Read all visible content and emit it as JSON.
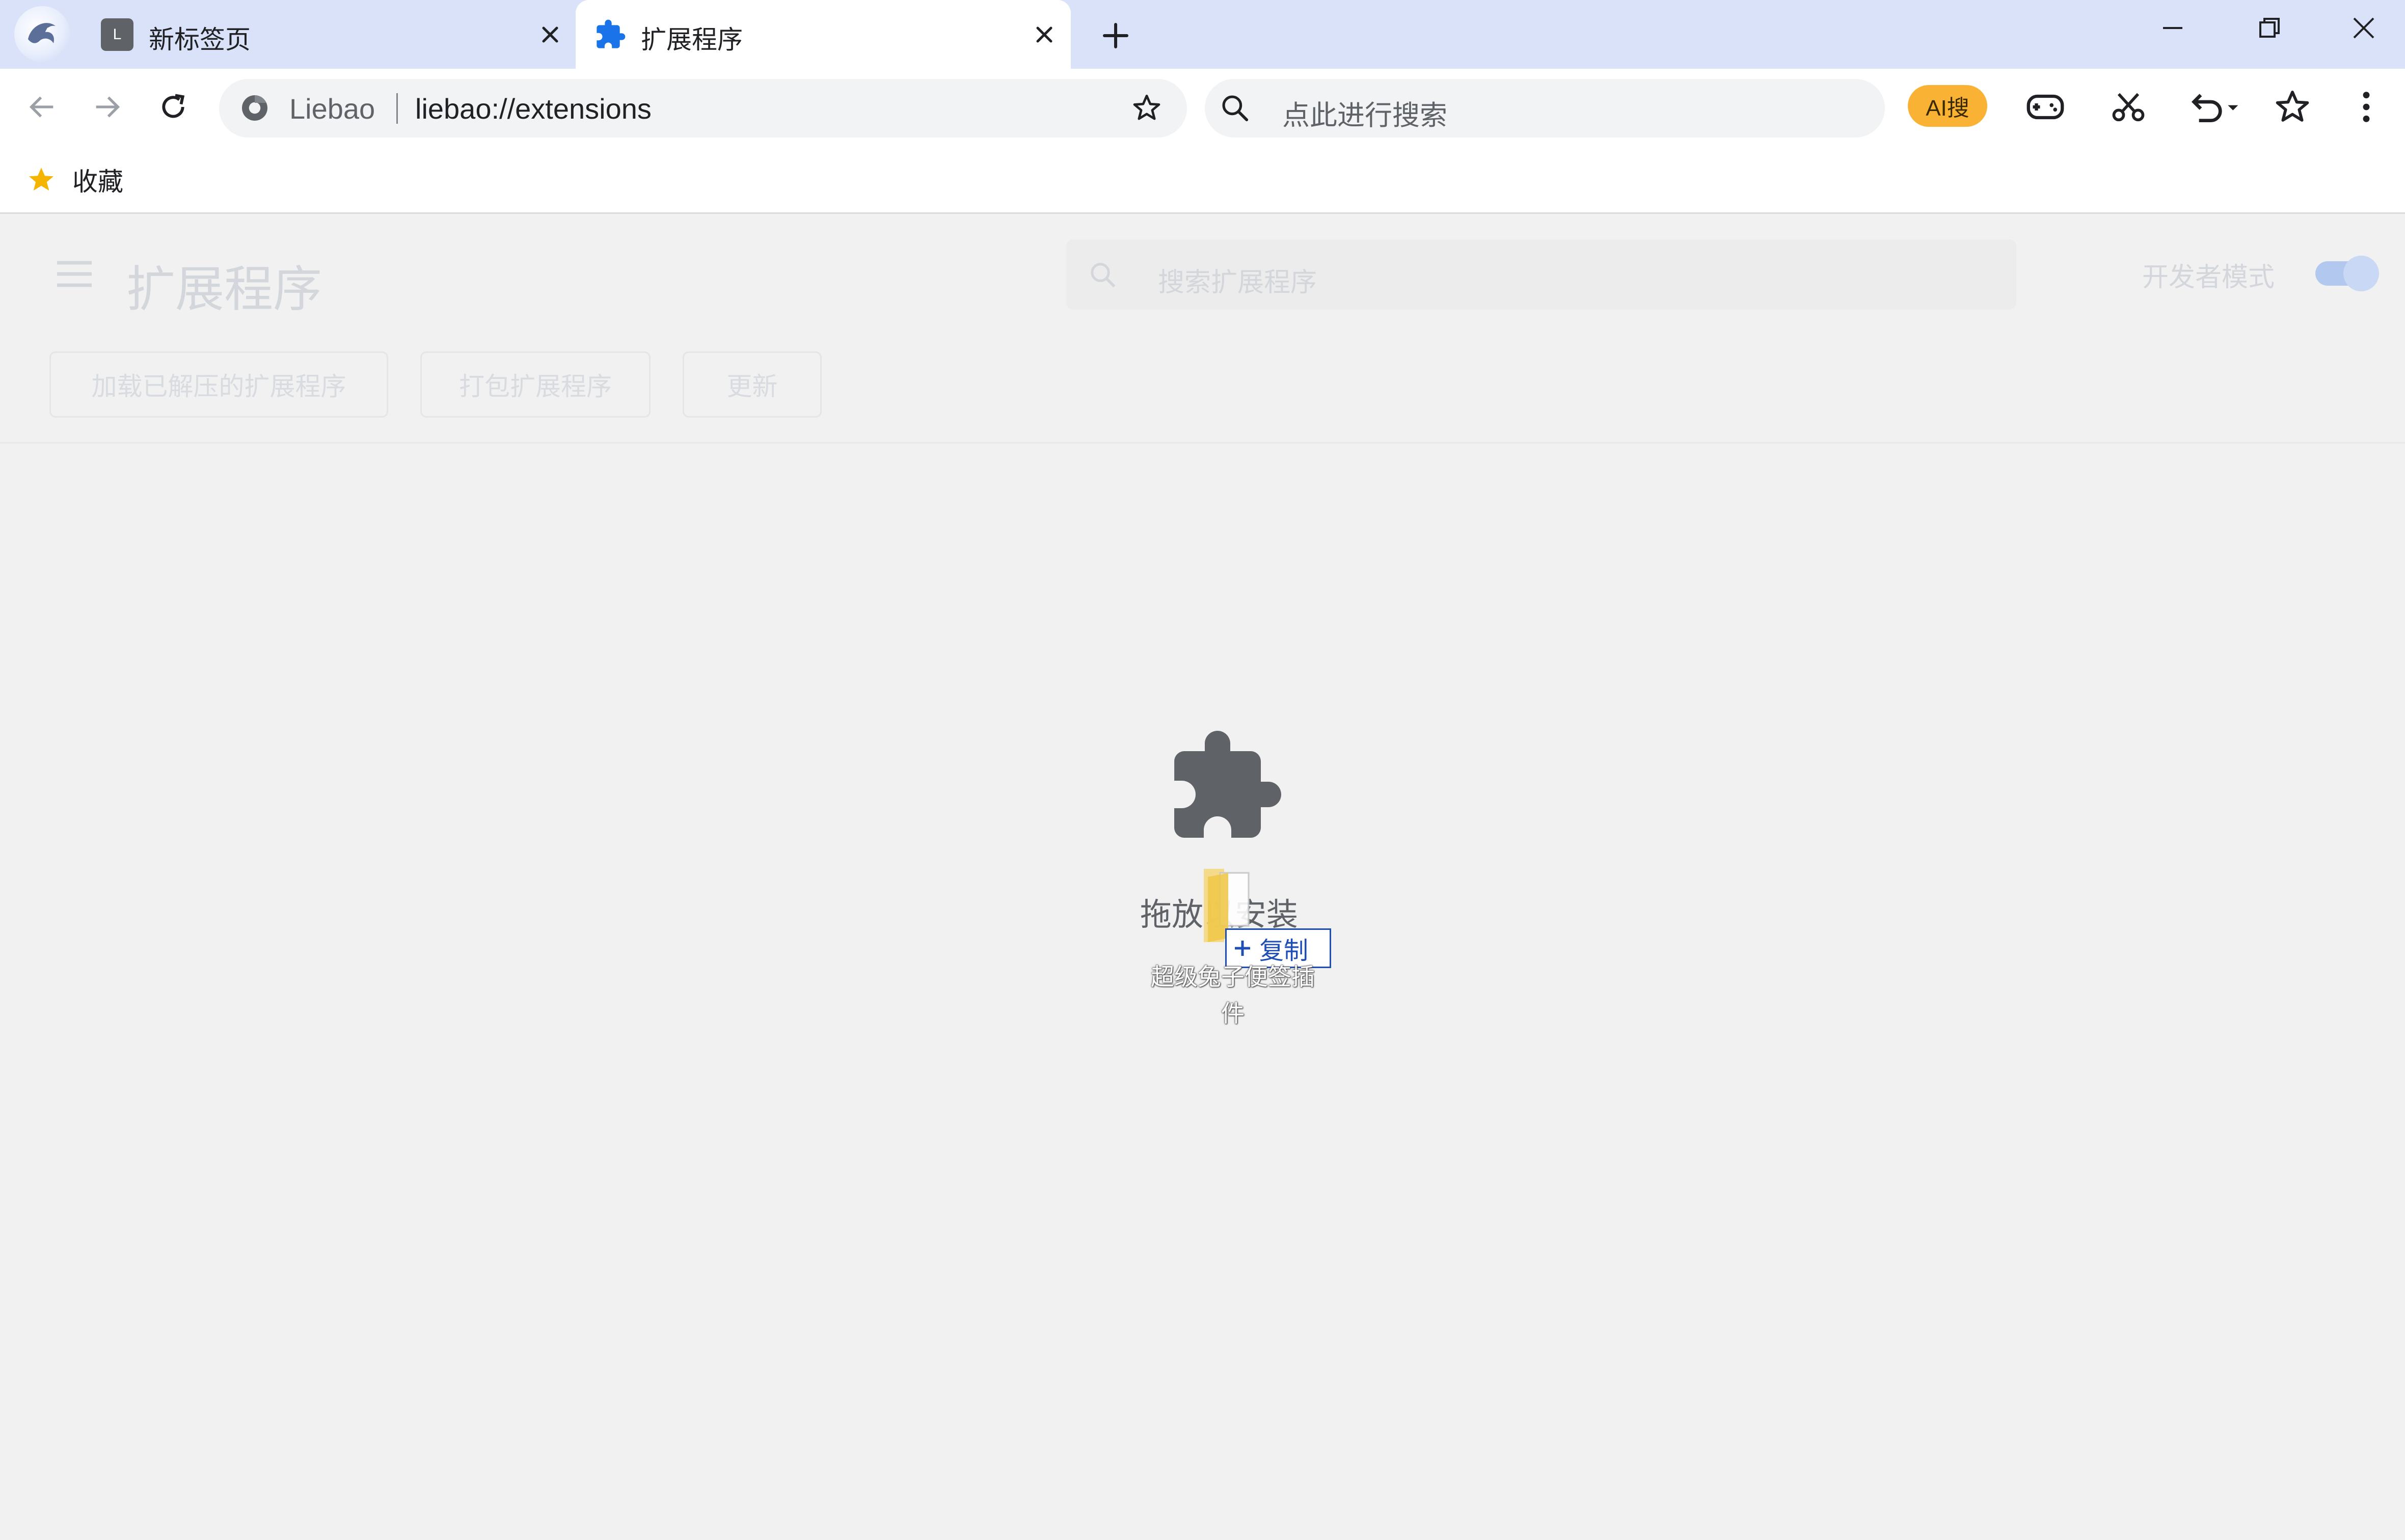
{
  "browser": {
    "tabs": [
      {
        "title": "新标签页",
        "favicon_letter": "L"
      },
      {
        "title": "扩展程序"
      }
    ],
    "address_bar": {
      "site_name": "Liebao",
      "url": "liebao://extensions"
    },
    "search_box": {
      "placeholder": "点此进行搜索"
    },
    "ai_badge": "AI搜",
    "bookmarks": [
      {
        "label": "收藏"
      }
    ]
  },
  "extensions_page": {
    "title": "扩展程序",
    "search_placeholder": "搜索扩展程序",
    "developer_mode_label": "开发者模式",
    "developer_mode_on": true,
    "buttons": {
      "load_unpacked": "加载已解压的扩展程序",
      "pack": "打包扩展程序",
      "update": "更新"
    },
    "drop_overlay": {
      "label": "拖放以安装",
      "drag_badge": "复制",
      "dragged_file_name": "超级兔子便签插件"
    }
  },
  "colors": {
    "tabstrip": "#d9e2f8",
    "accent_blue": "#1a73e8",
    "ai_badge": "#f9b233",
    "bookmark_star": "#f4b400",
    "puzzle_icon": "#5f6368"
  },
  "icons": [
    "browser-logo-icon",
    "extension-puzzle-icon",
    "close-icon",
    "plus-icon",
    "minimize-icon",
    "restore-icon",
    "back-icon",
    "forward-icon",
    "reload-icon",
    "site-info-icon",
    "star-icon",
    "search-icon",
    "gamepad-icon",
    "scissors-icon",
    "undo-icon",
    "menu-dots-icon",
    "hamburger-menu-icon",
    "folder-icon"
  ]
}
